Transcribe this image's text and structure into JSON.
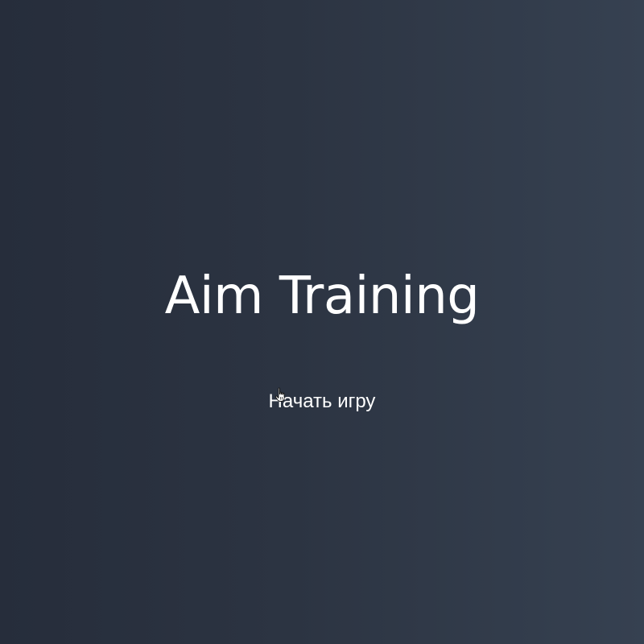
{
  "game": {
    "title": "Aim Training",
    "start_label": "Начать игру"
  },
  "icons": {
    "cursor": "hand-pointer-icon"
  },
  "colors": {
    "background_left": "#262d3b",
    "background_right": "#364151",
    "text": "#ffffff"
  }
}
